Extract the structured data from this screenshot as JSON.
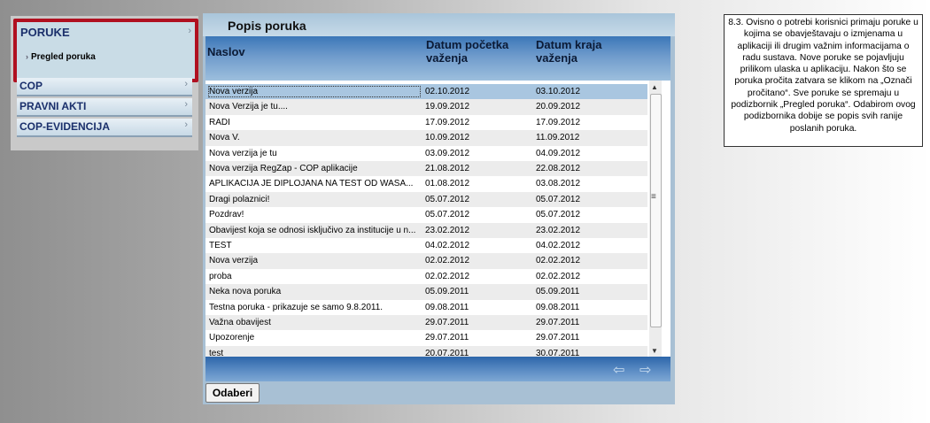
{
  "sidebar": {
    "active": {
      "label": "PORUKE",
      "sub_item": "Pregled poruka"
    },
    "items": [
      {
        "label": "COP"
      },
      {
        "label": "PRAVNI AKTI"
      },
      {
        "label": "COP-EVIDENCIJA"
      }
    ]
  },
  "panel": {
    "title": "Popis poruka",
    "columns": [
      "Naslov",
      "Datum početka važenja",
      "Datum kraja važenja"
    ],
    "column_lines": [
      [
        "Naslov"
      ],
      [
        "Datum početka",
        "važenja"
      ],
      [
        "Datum kraja",
        "važenja"
      ]
    ],
    "rows": [
      [
        "Nova verzija",
        "02.10.2012",
        "03.10.2012"
      ],
      [
        "Nova Verzija je tu....",
        "19.09.2012",
        "20.09.2012"
      ],
      [
        "RADI",
        "17.09.2012",
        "17.09.2012"
      ],
      [
        "Nova V.",
        "10.09.2012",
        "11.09.2012"
      ],
      [
        "Nova verzija je tu",
        "03.09.2012",
        "04.09.2012"
      ],
      [
        "Nova verzija RegZap - COP aplikacije",
        "21.08.2012",
        "22.08.2012"
      ],
      [
        "APLIKACIJA JE DIPLOJANA NA TEST OD WASA...",
        "01.08.2012",
        "03.08.2012"
      ],
      [
        "Dragi polaznici!",
        "05.07.2012",
        "05.07.2012"
      ],
      [
        "Pozdrav!",
        "05.07.2012",
        "05.07.2012"
      ],
      [
        "Obavijest koja se odnosi isključivo za institucije u n...",
        "23.02.2012",
        "23.02.2012"
      ],
      [
        "TEST",
        "04.02.2012",
        "04.02.2012"
      ],
      [
        "Nova verzija",
        "02.02.2012",
        "02.02.2012"
      ],
      [
        "proba",
        "02.02.2012",
        "02.02.2012"
      ],
      [
        "Neka nova poruka",
        "05.09.2011",
        "05.09.2011"
      ],
      [
        "Testna poruka - prikazuje se samo 9.8.2011.",
        "09.08.2011",
        "09.08.2011"
      ],
      [
        "Važna obavijest",
        "29.07.2011",
        "29.07.2011"
      ],
      [
        "Upozorenje",
        "29.07.2011",
        "29.07.2011"
      ],
      [
        "test",
        "20.07.2011",
        "30.07.2011"
      ]
    ],
    "selected_row": 0,
    "select_button": "Odaberi",
    "pager_prev_icon": "arrow-left-icon",
    "pager_next_icon": "arrow-right-icon"
  },
  "note": {
    "text": "8.3.  Ovisno o potrebi korisnici primaju poruke u kojima se obavještavaju o izmjenama u aplikaciji ili drugim važnim informacijama o radu sustava. Nove poruke se pojavljuju prilikom ulaska u aplikaciju. Nakon što se poruka pročita zatvara se klikom na „Označi pročitano“. Sve poruke se spremaju u podizbornik „Pregled poruka“. Odabirom ovog podizbornika dobije se popis svih ranije poslanih poruka."
  }
}
